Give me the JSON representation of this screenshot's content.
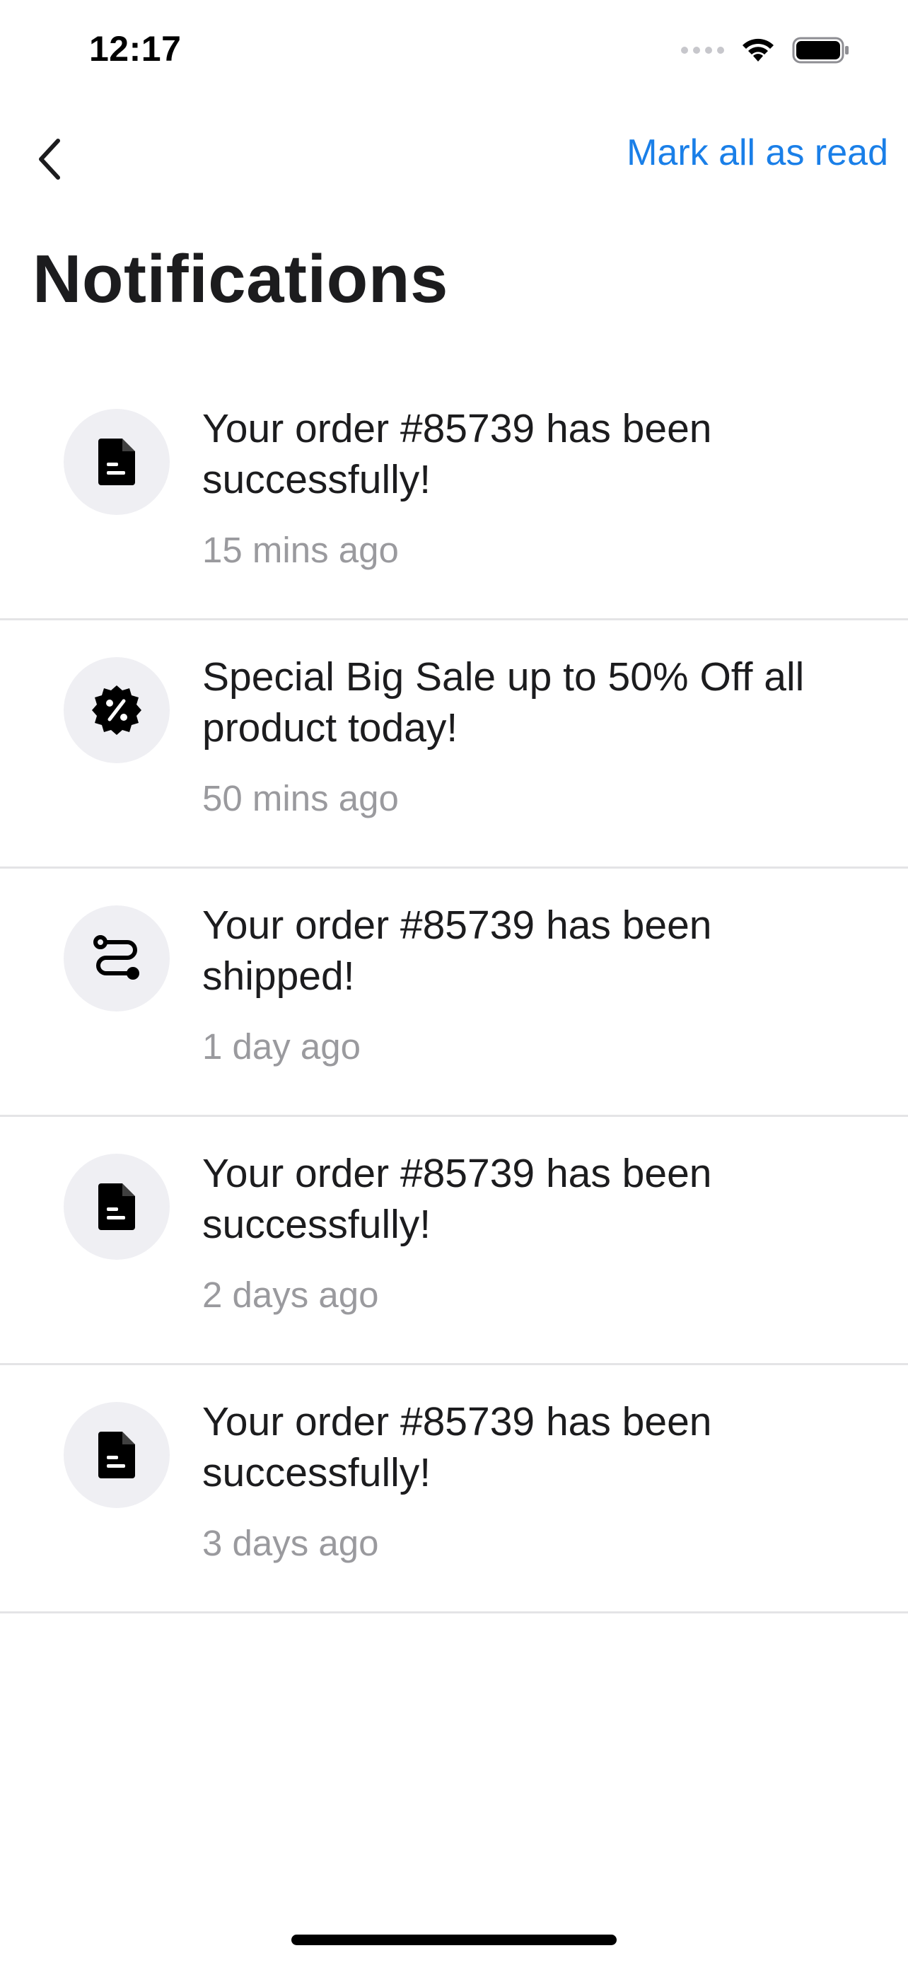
{
  "status_bar": {
    "time": "12:17",
    "signal_icon": "signal-dots-icon",
    "wifi_icon": "wifi-icon",
    "battery_icon": "battery-icon"
  },
  "nav": {
    "back_icon": "chevron-left-icon",
    "mark_all_label": "Mark all as read"
  },
  "page": {
    "title": "Notifications"
  },
  "notifications": [
    {
      "icon": "document-icon",
      "message": "Your order #85739 has been successfully!",
      "time": "15 mins ago"
    },
    {
      "icon": "discount-badge-icon",
      "message": "Special Big Sale up to 50% Off all product today!",
      "time": "50 mins ago"
    },
    {
      "icon": "route-icon",
      "message": "Your order #85739 has been shipped!",
      "time": "1 day ago"
    },
    {
      "icon": "document-icon",
      "message": "Your order #85739 has been successfully!",
      "time": "2 days ago"
    },
    {
      "icon": "document-icon",
      "message": "Your order #85739 has been successfully!",
      "time": "3 days ago"
    }
  ],
  "colors": {
    "accent": "#1a7fe8",
    "icon_bg": "#efeff3",
    "secondary_text": "#9a9a9e",
    "divider": "#e4e4e6"
  }
}
